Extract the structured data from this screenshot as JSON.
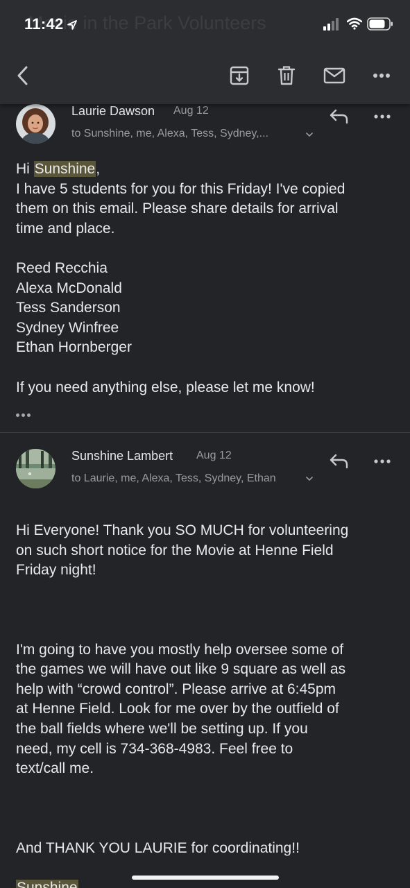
{
  "status_bar": {
    "time": "11:42"
  },
  "header": {
    "background_title": "Movie in the Park Volunteers"
  },
  "toolbar": {
    "icons": [
      "back-icon",
      "archive-icon",
      "trash-icon",
      "mail-icon",
      "more-icon"
    ]
  },
  "messages": [
    {
      "sender": "Laurie Dawson",
      "date": "Aug 12",
      "recipients": "to Sunshine, me, Alexa, Tess, Sydney,...",
      "body": {
        "greeting_prefix": "Hi ",
        "greeting_name": "Sunshine",
        "greeting_suffix": ",",
        "lines": [
          "I have 5 students for you for this Friday! I've copied",
          "them on this email. Please share details for arrival",
          "time and place."
        ],
        "students": [
          "Reed Recchia",
          "Alexa McDonald",
          "Tess Sanderson",
          "Sydney Winfree",
          "Ethan Hornberger"
        ],
        "closing": "If you need anything else, please let me know!"
      }
    },
    {
      "sender": "Sunshine Lambert",
      "date": "Aug 12",
      "recipients": "to Laurie, me, Alexa, Tess, Sydney, Ethan",
      "body": {
        "para1": [
          "Hi Everyone!  Thank you SO MUCH for volunteering",
          "on such short notice for the Movie at Henne Field",
          "Friday night!"
        ],
        "para2": [
          "I'm going to have you mostly help oversee some of",
          "the games we will have out like 9 square as well as",
          "help with “crowd control”.   Please arrive at 6:45pm",
          "at Henne Field.  Look for me over by the outfield of",
          "the ball fields where we'll be setting up.  If you",
          "need, my cell is 734-368-4983.  Feel free to",
          "text/call me."
        ],
        "para3": "And THANK YOU LAURIE for coordinating!!",
        "signature": "Sunshine"
      }
    }
  ],
  "colors": {
    "background": "#232427",
    "header": "#2c2d31",
    "highlight": "#5a5639",
    "secondary_text": "#9a9ba0"
  }
}
